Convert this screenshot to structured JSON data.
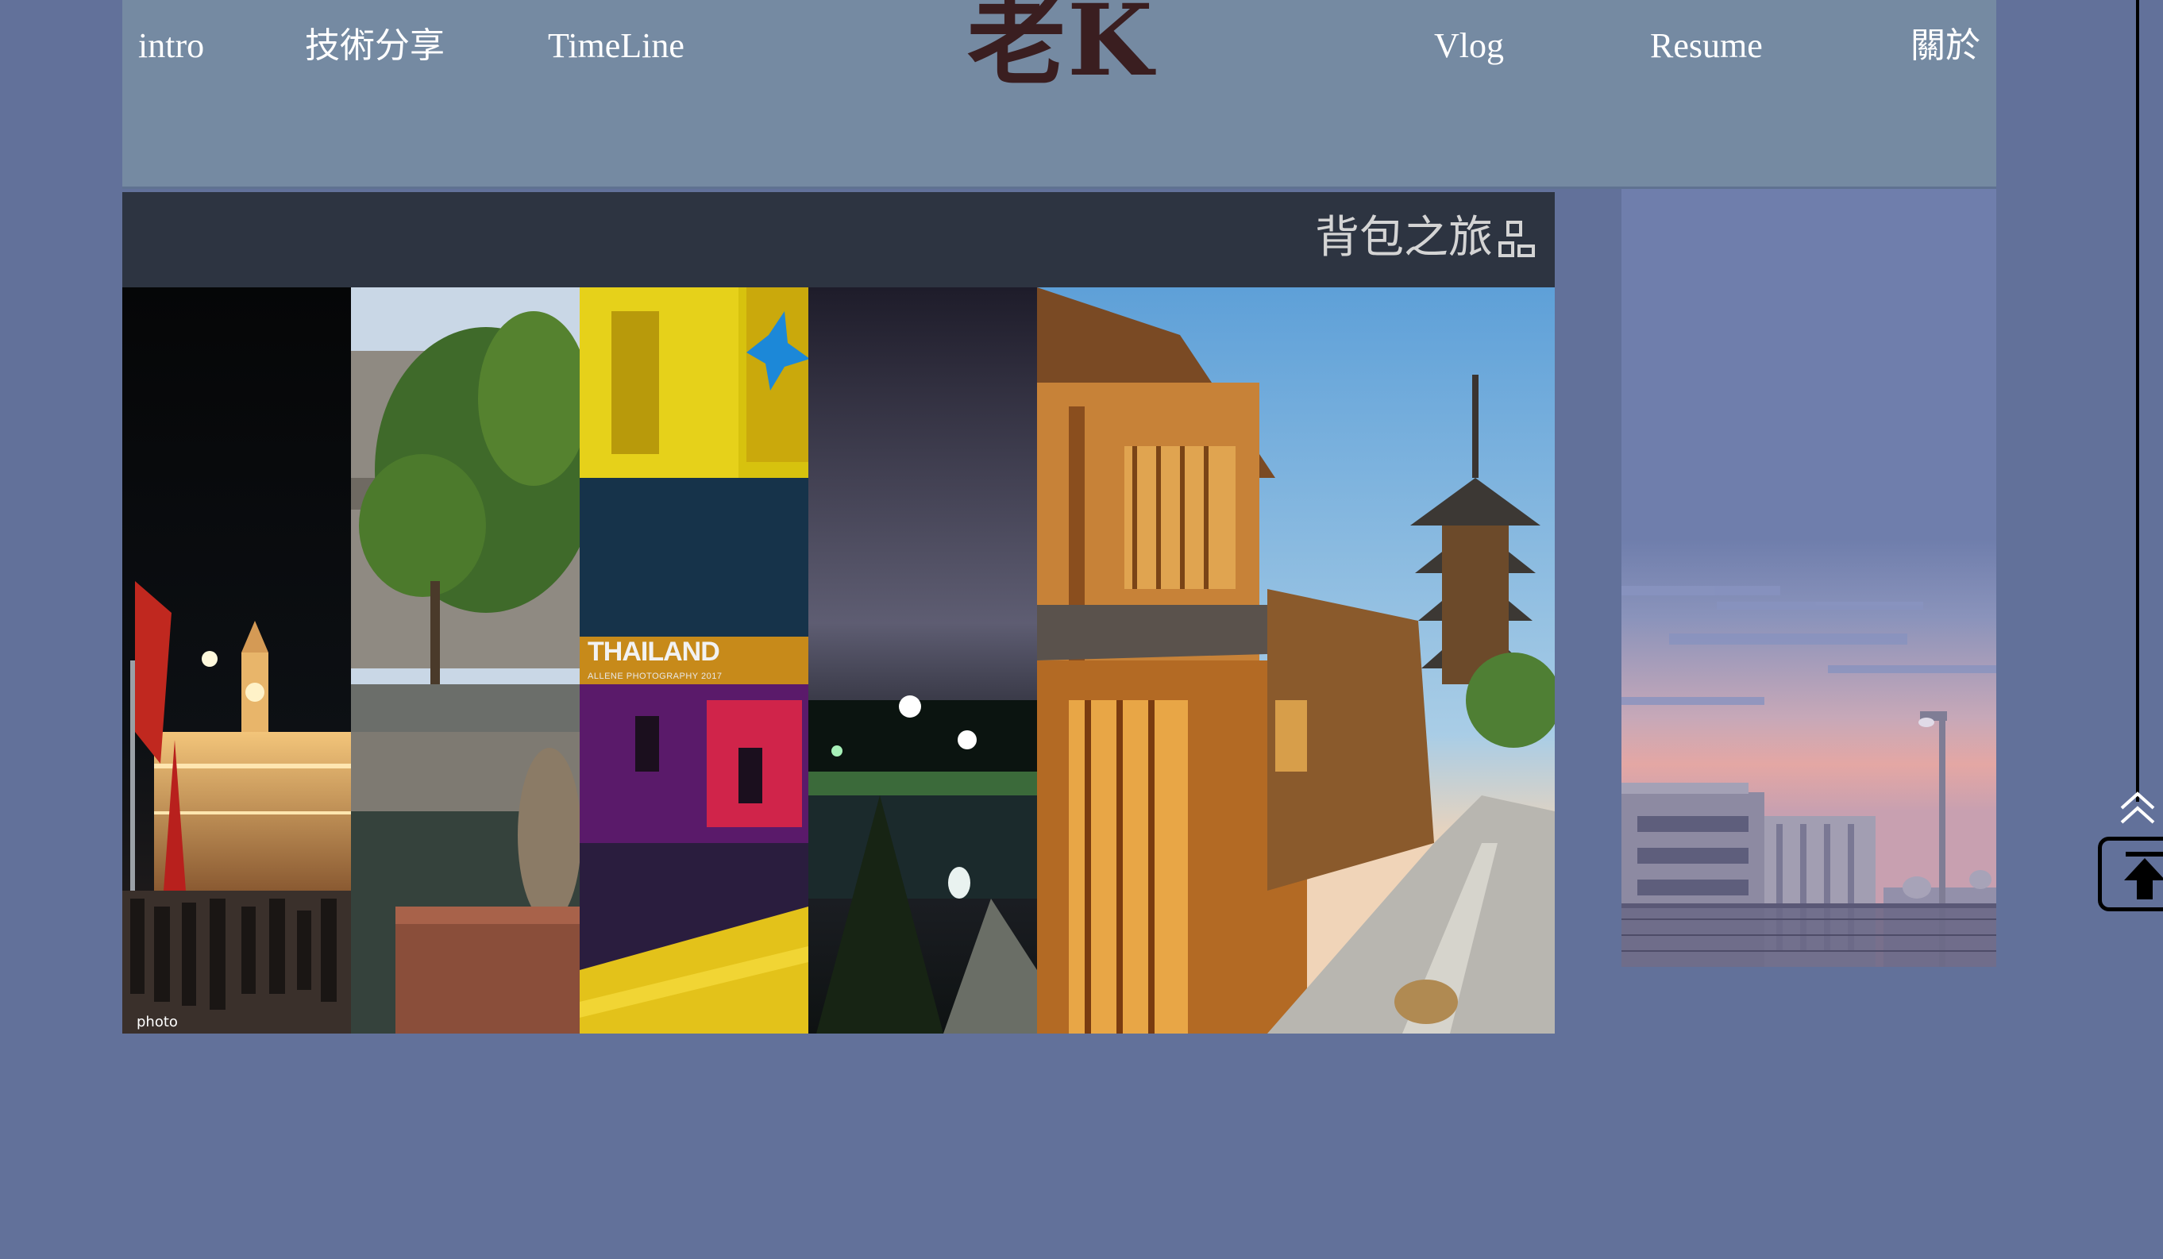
{
  "header": {
    "brand": "老K",
    "nav_left": [
      "intro",
      "技術分享",
      "TimeLine"
    ],
    "nav_right": [
      "Vlog",
      "Resume",
      "關於"
    ]
  },
  "gallery": {
    "title": "背包之旅",
    "title_icon": "sitemap-icon",
    "photos": [
      {
        "name": "photo-clocktower-night",
        "watermark": "photo"
      },
      {
        "name": "photo-canal-tree"
      },
      {
        "name": "photo-thailand-neon",
        "stamp": "THAILAND",
        "stamp_sub": "ALLENE PHOTOGRAPHY 2017"
      },
      {
        "name": "photo-park-night"
      },
      {
        "name": "photo-kyoto-pagoda"
      }
    ]
  },
  "sidebar": {
    "image": "pixel-art-sunset-buildings"
  },
  "scroll_widget": {
    "icon": "back-to-top-icon"
  },
  "colors": {
    "background": "#62719a",
    "header": "#758aa2",
    "card_head": "#2d3441",
    "brand_text": "#3a1e20"
  }
}
